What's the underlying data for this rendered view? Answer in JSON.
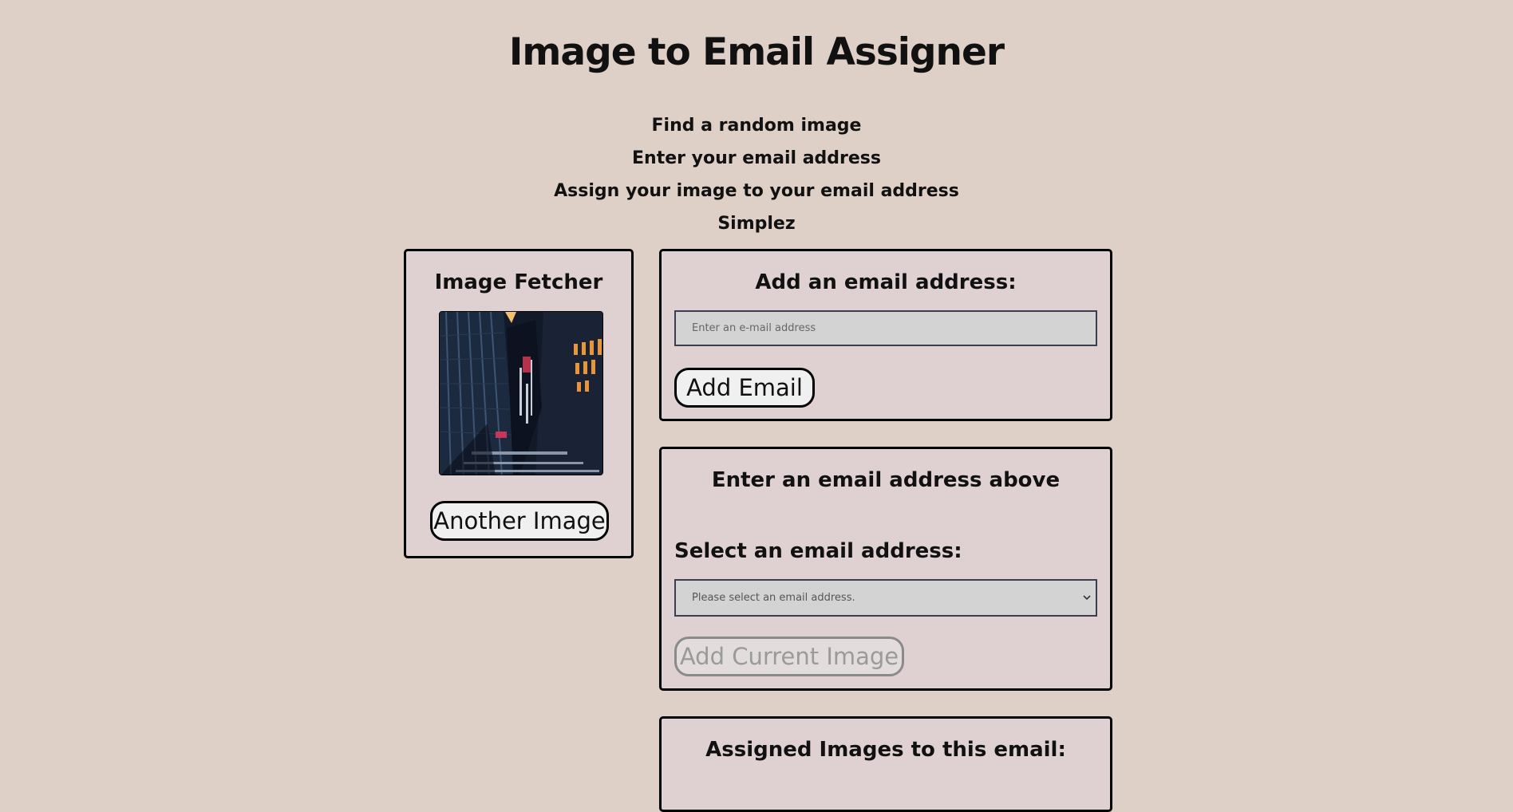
{
  "header": {
    "title": "Image to Email Assigner"
  },
  "intro": {
    "lines": [
      "Find a random image",
      "Enter your email address",
      "Assign your image to your email address",
      "Simplez"
    ]
  },
  "image_fetcher": {
    "heading": "Image Fetcher",
    "another_image_label": "Another Image"
  },
  "add_email": {
    "heading": "Add an email address:",
    "input_placeholder": "Enter an e-mail address",
    "input_value": "",
    "button_label": "Add Email"
  },
  "assign": {
    "status": "Enter an email address above",
    "select_label": "Select an email address:",
    "select_value": "Please select an email address.",
    "add_image_label": "Add Current Image"
  },
  "assigned": {
    "heading": "Assigned Images to this email:"
  },
  "colors": {
    "background": "#dfd0c7",
    "panel": "#dfd1d2",
    "input": "#d3d3d3",
    "border": "#000000"
  },
  "icons": {
    "select_chevron": "chevron-down-icon"
  }
}
